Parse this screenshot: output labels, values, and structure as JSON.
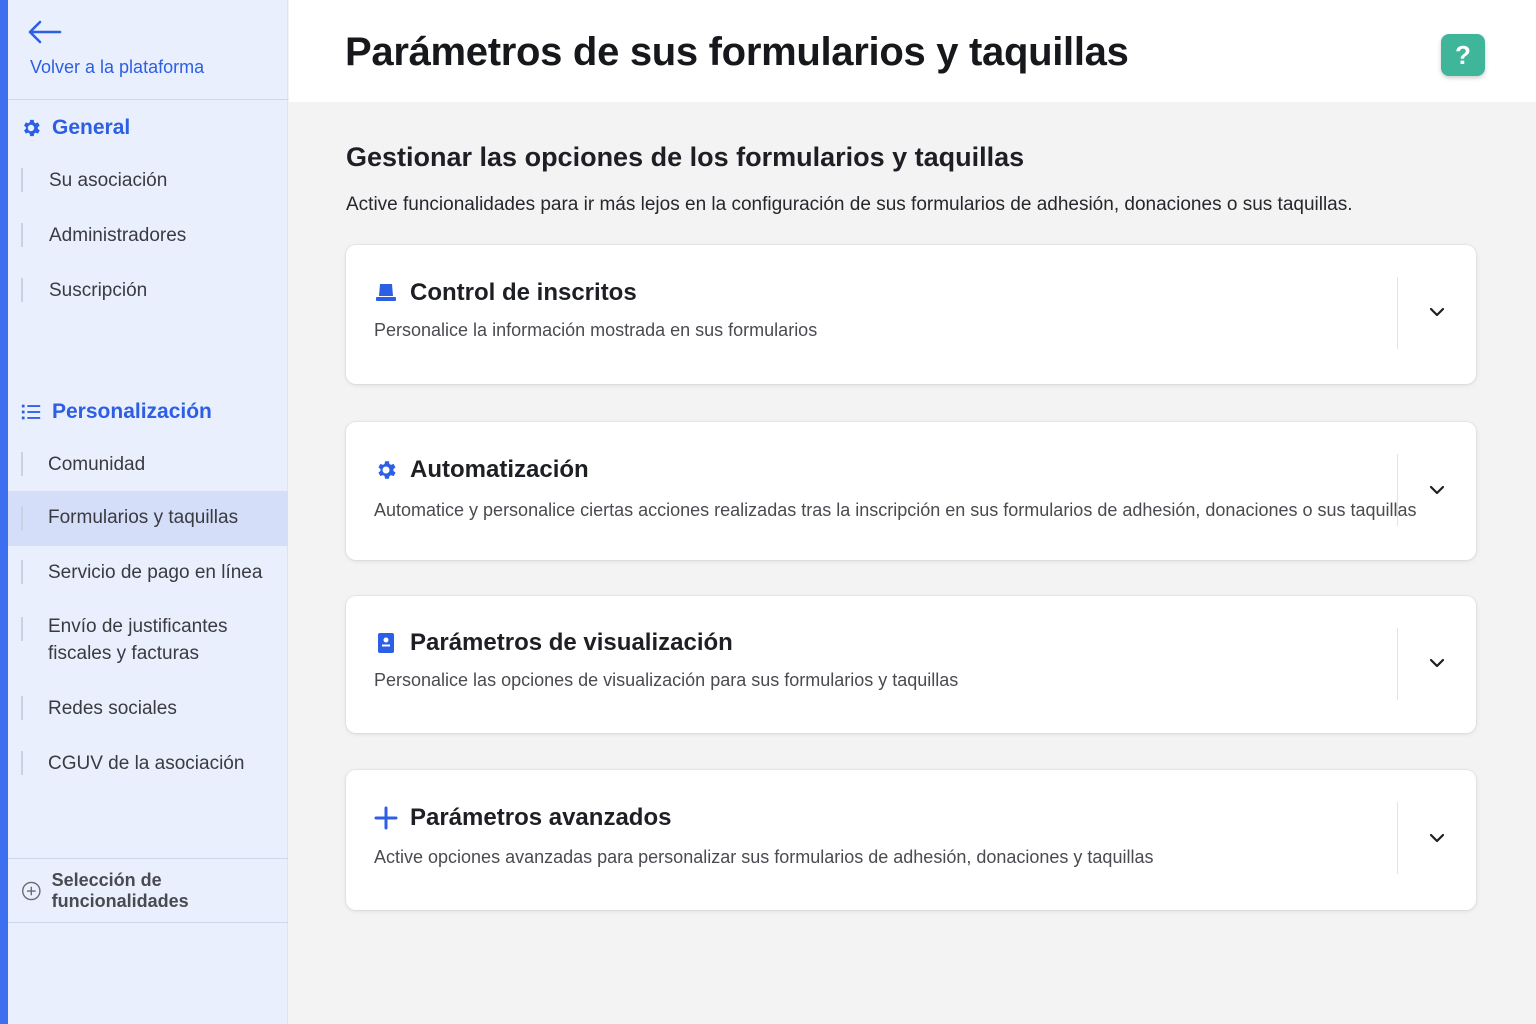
{
  "sidebar": {
    "back_label": "Volver a la plataforma",
    "sections": [
      {
        "title": "General",
        "icon": "gear-icon",
        "items": [
          "Su asociación",
          "Administradores",
          "Suscripción"
        ]
      },
      {
        "title": "Personalización",
        "icon": "list-icon",
        "items": [
          "Comunidad",
          "Formularios y taquillas",
          "Servicio de pago en línea",
          "Envío de justificantes",
          "fiscales y facturas",
          "Redes sociales",
          "CGUV de la asociación"
        ]
      }
    ],
    "active_item": "Formularios y taquillas",
    "feature_selection": "Selección de funcionalidades"
  },
  "header": {
    "title": "Parámetros de sus formularios y taquillas",
    "help_label": "?"
  },
  "main": {
    "heading": "Gestionar las opciones de los formularios y taquillas",
    "subheading": "Active funcionalidades para ir más lejos en la configuración de sus formularios de adhesión, donaciones o sus taquillas.",
    "cards": [
      {
        "title": "Control de inscritos",
        "icon": "stand-icon",
        "description": "Personalice la información mostrada en sus formularios"
      },
      {
        "title": "Automatización",
        "icon": "gear-icon",
        "description": "Automatice y personalice ciertas acciones realizadas tras la inscripción en sus formularios de adhesión, donaciones o sus taquillas"
      },
      {
        "title": "Parámetros de visualización",
        "icon": "badge-icon",
        "description": "Personalice las opciones de visualización para sus formularios y taquillas"
      },
      {
        "title": "Parámetros avanzados",
        "icon": "plus-icon",
        "description": "Active opciones avanzadas para personalizar sus formularios de adhesión, donaciones y taquillas"
      }
    ]
  },
  "colors": {
    "accent": "#2d5fe4",
    "rail": "#3d6ff0",
    "help": "#3fb59a",
    "sidebar_bg": "#e9effd",
    "active_bg": "#d4def9"
  }
}
